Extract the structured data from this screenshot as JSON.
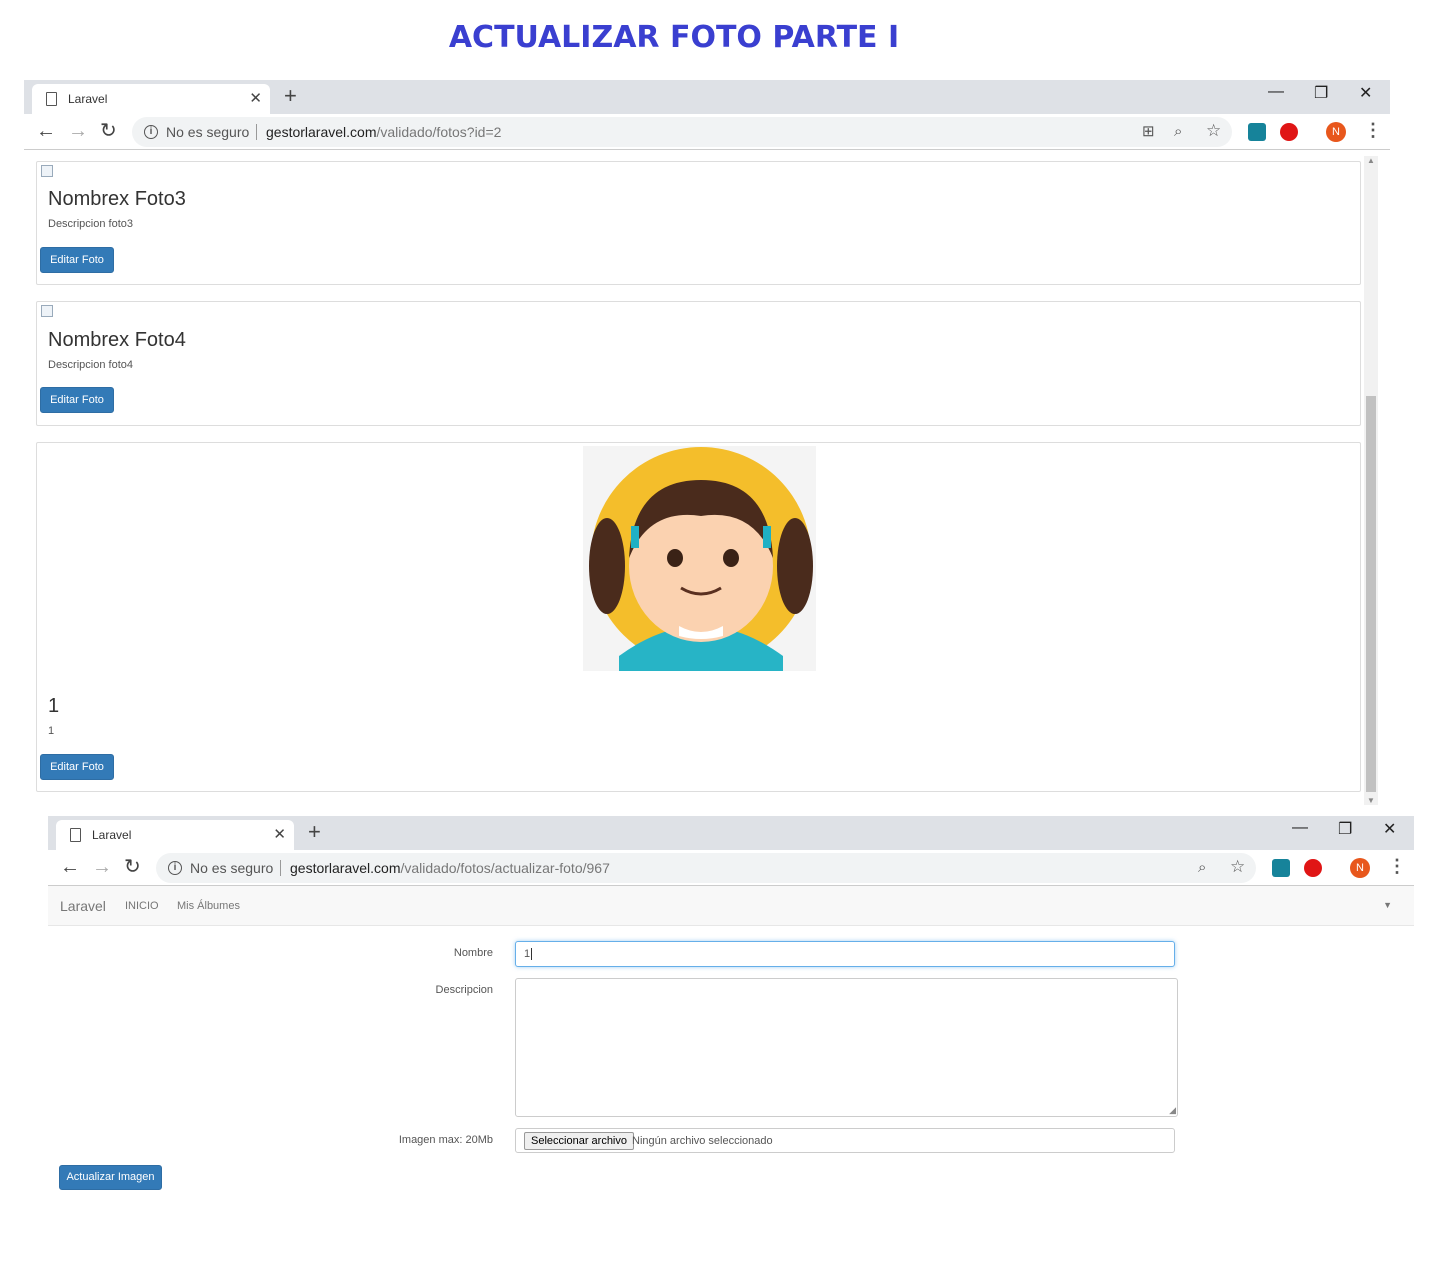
{
  "page_title": "ACTUALIZAR FOTO PARTE I",
  "window1": {
    "tab_title": "Laravel",
    "security_text": "No es seguro",
    "url_host": "gestorlaravel.com",
    "url_path": "/validado/fotos?id=2",
    "avatar_letter": "N",
    "cards": [
      {
        "title": "Nombrex Foto3",
        "description": "Descripcion foto3",
        "button": "Editar Foto"
      },
      {
        "title": "Nombrex Foto4",
        "description": "Descripcion foto4",
        "button": "Editar Foto"
      },
      {
        "title": "1",
        "description": "1",
        "button": "Editar Foto"
      }
    ]
  },
  "window2": {
    "tab_title": "Laravel",
    "security_text": "No es seguro",
    "url_host": "gestorlaravel.com",
    "url_path": "/validado/fotos/actualizar-foto/967",
    "avatar_letter": "N",
    "navbar": {
      "brand": "Laravel",
      "links": [
        "INICIO",
        "Mis Álbumes"
      ]
    },
    "form": {
      "nombre_label": "Nombre",
      "nombre_value": "1",
      "descripcion_label": "Descripcion",
      "imagen_label": "Imagen max: 20Mb",
      "file_button": "Seleccionar archivo",
      "file_status": "Ningún archivo seleccionado",
      "submit": "Actualizar Imagen"
    }
  },
  "colors": {
    "title": "#3a3fd0",
    "button": "#337ab7",
    "avatar": "#e8571c"
  }
}
